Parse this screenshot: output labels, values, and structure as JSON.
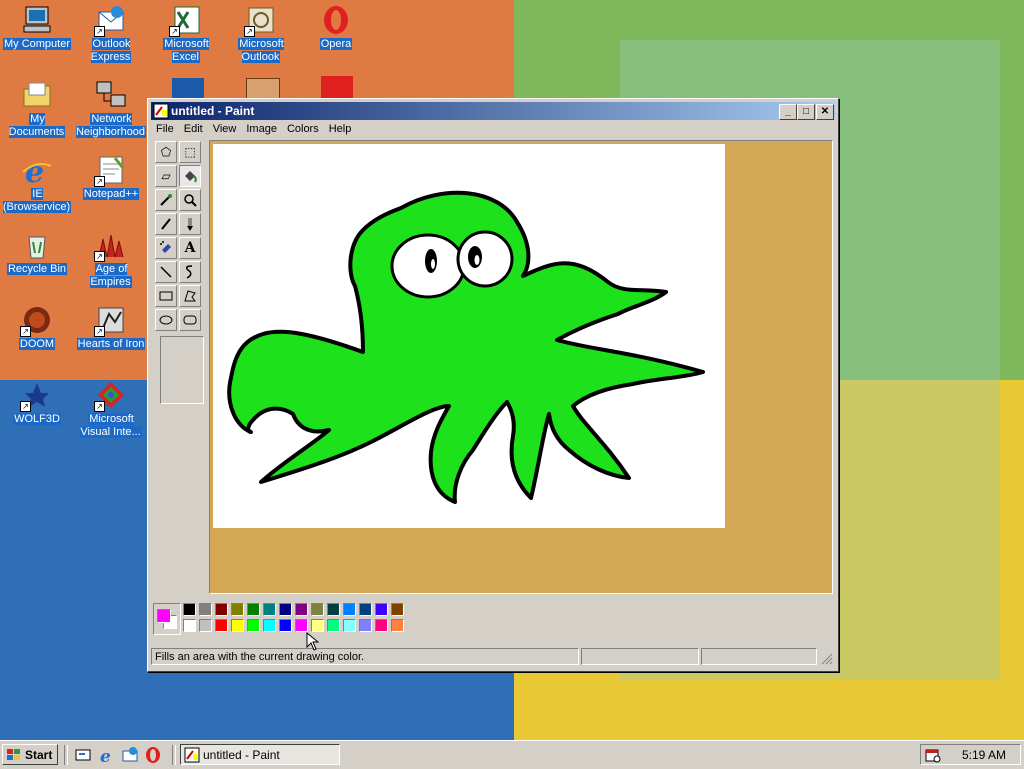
{
  "desktop": {
    "icons": [
      {
        "label": "My Computer"
      },
      {
        "label": "Outlook Express"
      },
      {
        "label": "Microsoft Excel"
      },
      {
        "label": "Microsoft Outlook"
      },
      {
        "label": "Opera"
      },
      {
        "label": "My Documents"
      },
      {
        "label": "Network Neighborhood"
      },
      {
        "label": "IE (Browservice)"
      },
      {
        "label": "Notepad++"
      },
      {
        "label": "Recycle Bin"
      },
      {
        "label": "Age of Empires"
      },
      {
        "label": "DOOM"
      },
      {
        "label": "Hearts of Iron"
      },
      {
        "label": "WOLF3D"
      },
      {
        "label": "Microsoft Visual Inte..."
      }
    ]
  },
  "paint": {
    "title": "untitled - Paint",
    "menu": [
      "File",
      "Edit",
      "View",
      "Image",
      "Colors",
      "Help"
    ],
    "tools": [
      "free-select",
      "rect-select",
      "eraser",
      "fill",
      "pick-color",
      "magnifier",
      "pencil",
      "brush",
      "airbrush",
      "text",
      "line",
      "curve",
      "rectangle",
      "polygon",
      "ellipse",
      "rounded-rectangle"
    ],
    "active_tool": "fill",
    "primary_color": "#ff00ff",
    "secondary_color": "#ffffff",
    "palette": [
      "#000000",
      "#808080",
      "#800000",
      "#808000",
      "#008000",
      "#008080",
      "#000080",
      "#800080",
      "#808040",
      "#004040",
      "#0080ff",
      "#004080",
      "#4000ff",
      "#804000",
      "#ffffff",
      "#c0c0c0",
      "#ff0000",
      "#ffff00",
      "#00ff00",
      "#00ffff",
      "#0000ff",
      "#ff00ff",
      "#ffff80",
      "#00ff80",
      "#80ffff",
      "#8080ff",
      "#ff0080",
      "#ff8040"
    ],
    "status": "Fills an area with the current drawing color.",
    "canvas_bg": "#d3a755",
    "drawing_fill": "#1de21b"
  },
  "taskbar": {
    "start_label": "Start",
    "task_label": "untitled - Paint",
    "clock": "5:19 AM"
  }
}
